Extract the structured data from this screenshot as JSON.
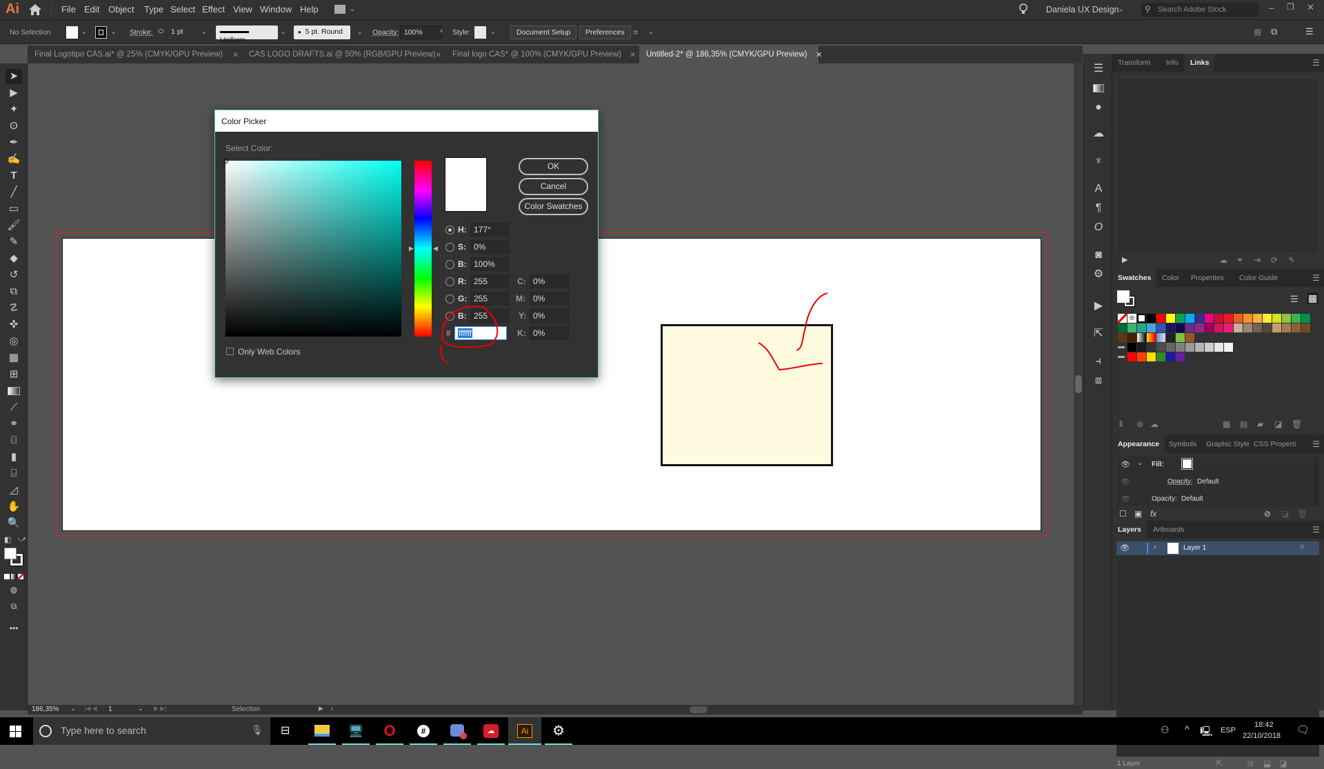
{
  "app": {
    "logo": "Ai"
  },
  "menubar": {
    "items": [
      "File",
      "Edit",
      "Object",
      "Type",
      "Select",
      "Effect",
      "View",
      "Window",
      "Help"
    ],
    "workspace": "Daniela UX Design",
    "search_placeholder": "Search Adobe Stock"
  },
  "control_bar": {
    "selection": "No Selection",
    "stroke_label": "Stroke:",
    "stroke_weight": "1 pt",
    "stroke_profile": "Uniform",
    "brush": "5 pt. Round",
    "opacity_label": "Opacity:",
    "opacity_value": "100%",
    "style_label": "Style:",
    "document_setup": "Document Setup",
    "preferences": "Preferences"
  },
  "doc_tabs": [
    {
      "label": "Final Logotipo CAS.ai* @ 25% (CMYK/GPU Preview)",
      "active": false
    },
    {
      "label": "CAS LOGO DRAFTS.ai @ 50% (RGB/GPU Preview)",
      "active": false
    },
    {
      "label": "Final logo CAS* @ 100% (CMYK/GPU Preview)",
      "active": false
    },
    {
      "label": "Untitled-2* @ 186,35% (CMYK/GPU Preview)",
      "active": true
    }
  ],
  "tools": [
    "selection",
    "direct-selection",
    "magic-wand",
    "lasso",
    "pen",
    "curvature",
    "type",
    "line-segment",
    "rectangle",
    "paintbrush",
    "shaper",
    "eraser",
    "rotate",
    "scale",
    "warp",
    "free-transform",
    "shape-builder",
    "perspective-grid",
    "mesh",
    "gradient",
    "eyedropper",
    "blend",
    "symbol-sprayer",
    "column-graph",
    "artboard",
    "slice",
    "hand",
    "zoom"
  ],
  "color_picker": {
    "title": "Color Picker",
    "select_color": "Select Color:",
    "ok": "OK",
    "cancel": "Cancel",
    "color_swatches": "Color Swatches",
    "only_web_colors": "Only Web Colors",
    "only_web_colors_checked": false,
    "selected_mode": "H",
    "fields": {
      "H": "177°",
      "S": "0%",
      "B": "100%",
      "R": "255",
      "G": "255",
      "B2": "255",
      "hex": "ffffff",
      "C": "0%",
      "M": "0%",
      "Y": "0%",
      "K": "0%"
    },
    "labels": {
      "H": "H:",
      "S": "S:",
      "B": "B:",
      "R": "R:",
      "G": "G:",
      "B2": "B:",
      "hash": "#",
      "C": "C:",
      "M": "M:",
      "Y": "Y:",
      "K": "K:"
    },
    "current_color": "#ffffff",
    "hue_color": "#00fff1"
  },
  "artboard": {
    "rect_fill": "#fefbe0"
  },
  "panels": {
    "top_tabs": [
      "Transform",
      "Info",
      "Links"
    ],
    "top_active": "Links",
    "swatches_tabs": [
      "Swatches",
      "Color",
      "Properties",
      "Color Guide"
    ],
    "swatches_active": "Swatches",
    "swatch_rows": [
      [
        "#ffffff",
        "#ffffff",
        "#ffffff",
        "#000000",
        "#ff0000",
        "#ffff00",
        "#00a651",
        "#00aeef",
        "#2e3192",
        "#ec008c",
        "#c8102e",
        "#ed1c24",
        "#f15a24",
        "#f7941d",
        "#fbb040",
        "#f9ed32",
        "#d7e021",
        "#8dc63f",
        "#39b54a",
        "#009245"
      ],
      [
        "#006837",
        "#3cb371",
        "#22a88e",
        "#4aa3d6",
        "#2b59a8",
        "#1b1464",
        "#0d0a4e",
        "#662d91",
        "#93278f",
        "#9e005d",
        "#d4145a",
        "#ed1e79",
        "#c7b299",
        "#998675",
        "#736357",
        "#534741",
        "#c69c6d",
        "#a67c52",
        "#8c6239",
        "#754c24"
      ],
      [
        "#603813",
        "#42210b",
        "#888888",
        "#f9c80e",
        "#8fa7d8",
        "#222222",
        "#7fbf3f",
        "#a0522d"
      ],
      [
        "#000000",
        "#1a1a1a",
        "#333333",
        "#4d4d4d",
        "#666666",
        "#808080",
        "#999999",
        "#b3b3b3",
        "#cccccc",
        "#e6e6e6",
        "#f2f2f2"
      ],
      [
        "#ff0000",
        "#ff4000",
        "#ffdd00",
        "#2e8b2e",
        "#1b1aa0",
        "#6a1ba0"
      ]
    ],
    "appearance_tabs": [
      "Appearance",
      "Symbols",
      "Graphic Style",
      "CSS Properti"
    ],
    "appearance_active": "Appearance",
    "appearance": {
      "fill_label": "Fill:",
      "opacity1_label": "Opacity:",
      "opacity1_value": "Default",
      "opacity2_label": "Opacity:",
      "opacity2_value": "Default"
    },
    "layers_tabs": [
      "Layers",
      "Artboards"
    ],
    "layers_active": "Layers",
    "layers": [
      {
        "name": "Layer 1"
      }
    ],
    "layers_count": "1 Layer"
  },
  "status_bar": {
    "zoom": "186,35%",
    "artboard_number": "1",
    "tool": "Selection"
  },
  "taskbar": {
    "search_placeholder": "Type here to search",
    "apps": [
      "file-explorer",
      "network",
      "opera",
      "slack",
      "discord",
      "creative-cloud",
      "illustrator",
      "settings"
    ],
    "language": "ESP",
    "time": "18:42",
    "date": "22/10/2018"
  }
}
